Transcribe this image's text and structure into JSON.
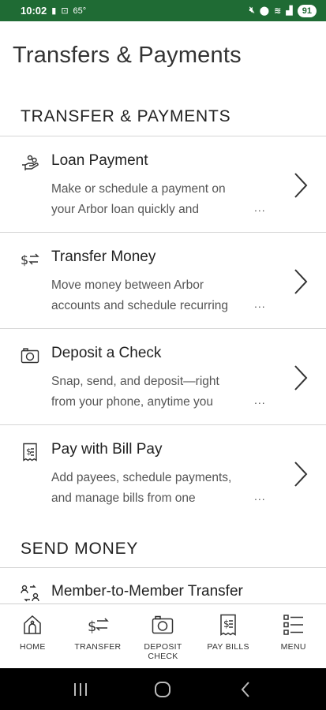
{
  "status_bar": {
    "time": "10:02",
    "temp": "65°",
    "battery": "91"
  },
  "page_title": "Transfers & Payments",
  "sections": {
    "transfer_payments": "TRANSFER & PAYMENTS",
    "send_money": "SEND MONEY"
  },
  "items": [
    {
      "title": "Loan Payment",
      "desc_line1": "Make or schedule a payment on",
      "desc_line2": "your Arbor loan quickly and",
      "icon": "hand-coins-icon"
    },
    {
      "title": "Transfer Money",
      "desc_line1": "Move money between Arbor",
      "desc_line2": "accounts and schedule recurring",
      "icon": "transfer-icon"
    },
    {
      "title": "Deposit a Check",
      "desc_line1": "Snap, send, and deposit—right",
      "desc_line2": "from your phone, anytime you",
      "icon": "camera-icon"
    },
    {
      "title": "Pay with Bill Pay",
      "desc_line1": "Add payees, schedule payments,",
      "desc_line2": "and manage bills from one",
      "icon": "bill-icon"
    }
  ],
  "more_indicator": "...",
  "send_money_item": {
    "title": "Member-to-Member Transfer",
    "icon": "member-transfer-icon"
  },
  "bottom_nav": [
    {
      "label": "HOME",
      "icon": "home-icon"
    },
    {
      "label": "TRANSFER",
      "icon": "transfer-icon"
    },
    {
      "label": "DEPOSIT CHECK",
      "icon": "camera-icon"
    },
    {
      "label": "PAY BILLS",
      "icon": "bill-icon"
    },
    {
      "label": "MENU",
      "icon": "menu-icon"
    }
  ],
  "colors": {
    "status_bar": "#1f6b34",
    "divider": "#d6d6d6"
  }
}
